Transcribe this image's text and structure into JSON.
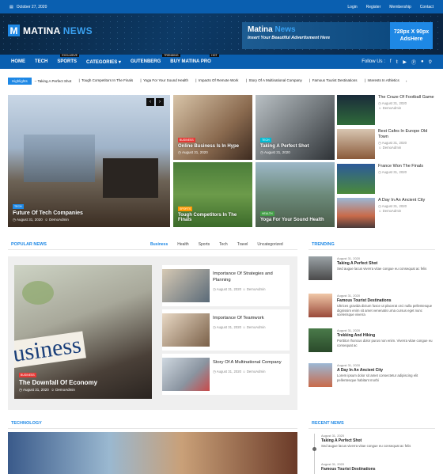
{
  "topbar": {
    "date": "October 27, 2020",
    "links": [
      "Login",
      "Register",
      "Membership",
      "Contact"
    ]
  },
  "header": {
    "logo_letter": "M",
    "logo_main": "MATINA",
    "logo_accent": "NEWS",
    "ad_title_main": "Matina",
    "ad_title_accent": "News",
    "ad_subtitle": "Insert Your Beautiful Advertisment Here",
    "ad_size": "728px X 90px",
    "ad_here": "AdsHere"
  },
  "nav": {
    "items": [
      {
        "label": "HOME",
        "badge": ""
      },
      {
        "label": "TECH",
        "badge": ""
      },
      {
        "label": "SPORTS",
        "badge": "EXCLUSIVE"
      },
      {
        "label": "CATEGORIES",
        "badge": ""
      },
      {
        "label": "GUTENBERG",
        "badge": ""
      },
      {
        "label": "BUY MATINA PRO",
        "badge": "TRENDING"
      }
    ],
    "hot_badge": "HOT",
    "follow_label": "Follow Us :",
    "social_icons": [
      "facebook-icon",
      "twitter-icon",
      "youtube-icon",
      "pinterest-icon",
      "vk-icon",
      "search-icon"
    ]
  },
  "ticker": {
    "label": "Highlights",
    "items": [
      "Taking A Perfect Shot",
      "Tough Competitors In The Finals",
      "Yoga For Your Sound Health",
      "Impacts Of Remote Work",
      "Story Of A Multinational Company",
      "Famous Tourist Destinations",
      "Interests In Athletics"
    ]
  },
  "hero": {
    "main": {
      "tag": "TECH",
      "title": "Future Of Tech Companies",
      "date": "August 31, 2020",
      "author": "DemoAdmin"
    },
    "grid": [
      {
        "tag": "BUSINESS",
        "title": "Online Business Is In Hype",
        "date": "August 31, 2020"
      },
      {
        "tag": "TECH",
        "title": "Taking A Perfect Shot",
        "date": "August 31, 2020"
      },
      {
        "tag": "SPORTS",
        "title": "Tough Competitors In The Finals",
        "date": "August 31, 2020"
      },
      {
        "tag": "HEALTH",
        "title": "Yoga For Your Sound Health",
        "date": "August 31, 2020"
      }
    ],
    "side": [
      {
        "title": "The Craze Of Football Game",
        "date": "August 31, 2020",
        "author": "DemoAdmin"
      },
      {
        "title": "Best Cafes In Europe Old Town",
        "date": "August 31, 2020",
        "author": "DemoAdmin"
      },
      {
        "title": "France Won The Finals",
        "date": "August 31, 2020",
        "author": "DemoAdmin"
      },
      {
        "title": "A Day In An Ancient City",
        "date": "August 31, 2020",
        "author": "DemoAdmin"
      }
    ]
  },
  "popular": {
    "heading": "POPULAR NEWS",
    "tabs": [
      "Business",
      "Health",
      "Sports",
      "Tech",
      "Travel",
      "Uncategorized"
    ],
    "big": {
      "tag": "BUSINESS",
      "title": "The Downfall Of Economy",
      "date": "August 31, 2020",
      "author": "DemoAdmin",
      "image_text": "usiness"
    },
    "list": [
      {
        "title": "Importance Of Strategies and Planning",
        "date": "August 31, 2020",
        "author": "DemoAdmin"
      },
      {
        "title": "Importance Of Teamwork",
        "date": "August 31, 2020",
        "author": "DemoAdmin"
      },
      {
        "title": "Story Of A Multinational Company",
        "date": "August 31, 2020",
        "author": "DemoAdmin"
      }
    ]
  },
  "trending": {
    "heading": "TRENDING",
    "items": [
      {
        "date": "August 31, 2020",
        "title": "Taking A Perfect Shot",
        "excerpt": "Sed augue lacus viverra vitae congue eu consequat ac felis"
      },
      {
        "date": "August 31, 2020",
        "title": "Famous Tourist Destinations",
        "excerpt": "Ultrices gravida dictum fusce ut placerat orci nulla pellentesque dignissim enim sit amet venenatis urna cursus eget nunc scelerisque viverra"
      },
      {
        "date": "August 31, 2020",
        "title": "Trekking And Hiking",
        "excerpt": "Porttitor rhoncus dolor purus non enim. Viverra vitae congue eu consequat ac"
      },
      {
        "date": "August 31, 2020",
        "title": "A Day In An Ancient City",
        "excerpt": "Lorem ipsum dolor sit amet consectetur adipiscing elit pellentesque habitant morbi"
      }
    ]
  },
  "technology": {
    "heading": "TECHNOLOGY"
  },
  "recent": {
    "heading": "RECENT NEWS",
    "items": [
      {
        "date": "August 31, 2020",
        "title": "Taking A Perfect Shot",
        "excerpt": "Sed augue lacus viverra vitae congue eu consequat ac felis"
      },
      {
        "date": "August 31, 2020",
        "title": "Famous Tourist Destinations",
        "excerpt": ""
      }
    ]
  },
  "colors": {
    "brand": "#0a5fb0",
    "accent": "#1e88e5",
    "tag_red": "#e53935",
    "tag_cyan": "#00bcd4",
    "tag_orange": "#ff9800",
    "tag_green": "#43a047"
  }
}
